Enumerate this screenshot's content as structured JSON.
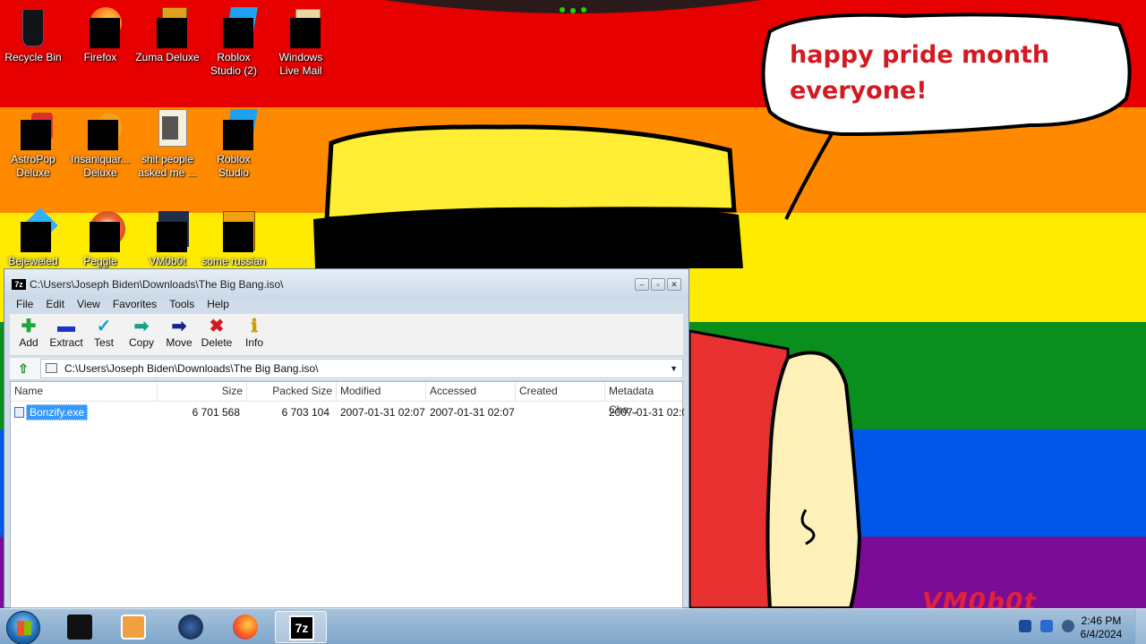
{
  "desktop": {
    "icons": [
      {
        "label": "Recycle Bin",
        "icon": "recycle-bin-icon"
      },
      {
        "label": "Firefox",
        "icon": "firefox-icon"
      },
      {
        "label": "Zuma Deluxe",
        "icon": "zuma-icon"
      },
      {
        "label": "Roblox\nStudio (2)",
        "icon": "roblox-studio-icon"
      },
      {
        "label": "Windows\nLive Mail",
        "icon": "live-mail-icon"
      },
      {
        "label": "AstroPop\nDeluxe",
        "icon": "astropop-icon"
      },
      {
        "label": "Insaniquar...\nDeluxe",
        "icon": "insaniquarium-icon"
      },
      {
        "label": "shit people\nasked me ...",
        "icon": "folder-icon"
      },
      {
        "label": "Roblox\nStudio",
        "icon": "roblox-studio-icon"
      },
      {
        "label": "Bejeweled",
        "icon": "bejeweled-icon"
      },
      {
        "label": "Peggle",
        "icon": "peggle-icon"
      },
      {
        "label": "VM0b0t",
        "icon": "vm0b0t-icon"
      },
      {
        "label": "some russian",
        "icon": "document-icon"
      }
    ]
  },
  "wallpaper": {
    "speech": "happy pride month everyone!",
    "watermark": "VM0b0t",
    "stripe_colors": [
      "#e60000",
      "#ff8a00",
      "#ffeb00",
      "#0a8f1e",
      "#0057e8",
      "#7a0c96"
    ]
  },
  "window": {
    "title": "C:\\Users\\Joseph Biden\\Downloads\\The Big Bang.iso\\",
    "menu": [
      "File",
      "Edit",
      "View",
      "Favorites",
      "Tools",
      "Help"
    ],
    "toolbar": [
      {
        "label": "Add",
        "icon": "plus-icon",
        "color": "#1fa83a"
      },
      {
        "label": "Extract",
        "icon": "minus-icon",
        "color": "#1a33c8"
      },
      {
        "label": "Test",
        "icon": "check-icon",
        "color": "#1aa0c8"
      },
      {
        "label": "Copy",
        "icon": "copy-arrow-icon",
        "color": "#1aa088"
      },
      {
        "label": "Move",
        "icon": "move-arrow-icon",
        "color": "#13248a"
      },
      {
        "label": "Delete",
        "icon": "delete-x-icon",
        "color": "#d21a20"
      },
      {
        "label": "Info",
        "icon": "info-icon",
        "color": "#c8a000"
      }
    ],
    "address": "C:\\Users\\Joseph Biden\\Downloads\\The Big Bang.iso\\",
    "columns": [
      "Name",
      "Size",
      "Packed Size",
      "Modified",
      "Accessed",
      "Created",
      "Metadata Cha..."
    ],
    "rows": [
      {
        "name": "Bonzify.exe",
        "size": "6 701 568",
        "packed": "6 703 104",
        "modified": "2007-01-31 02:07",
        "accessed": "2007-01-31 02:07",
        "created": "",
        "metadata": "2007-01-31 02:0"
      }
    ]
  },
  "taskbar": {
    "time": "2:46 PM",
    "date": "6/4/2024",
    "items": [
      {
        "name": "vm-app",
        "icon": "black-box-icon"
      },
      {
        "name": "media-player",
        "icon": "media-player-icon"
      },
      {
        "name": "globe-app",
        "icon": "globe-icon"
      },
      {
        "name": "firefox",
        "icon": "firefox-icon"
      },
      {
        "name": "7-zip",
        "icon": "7zip-icon",
        "label": "7z"
      }
    ]
  }
}
